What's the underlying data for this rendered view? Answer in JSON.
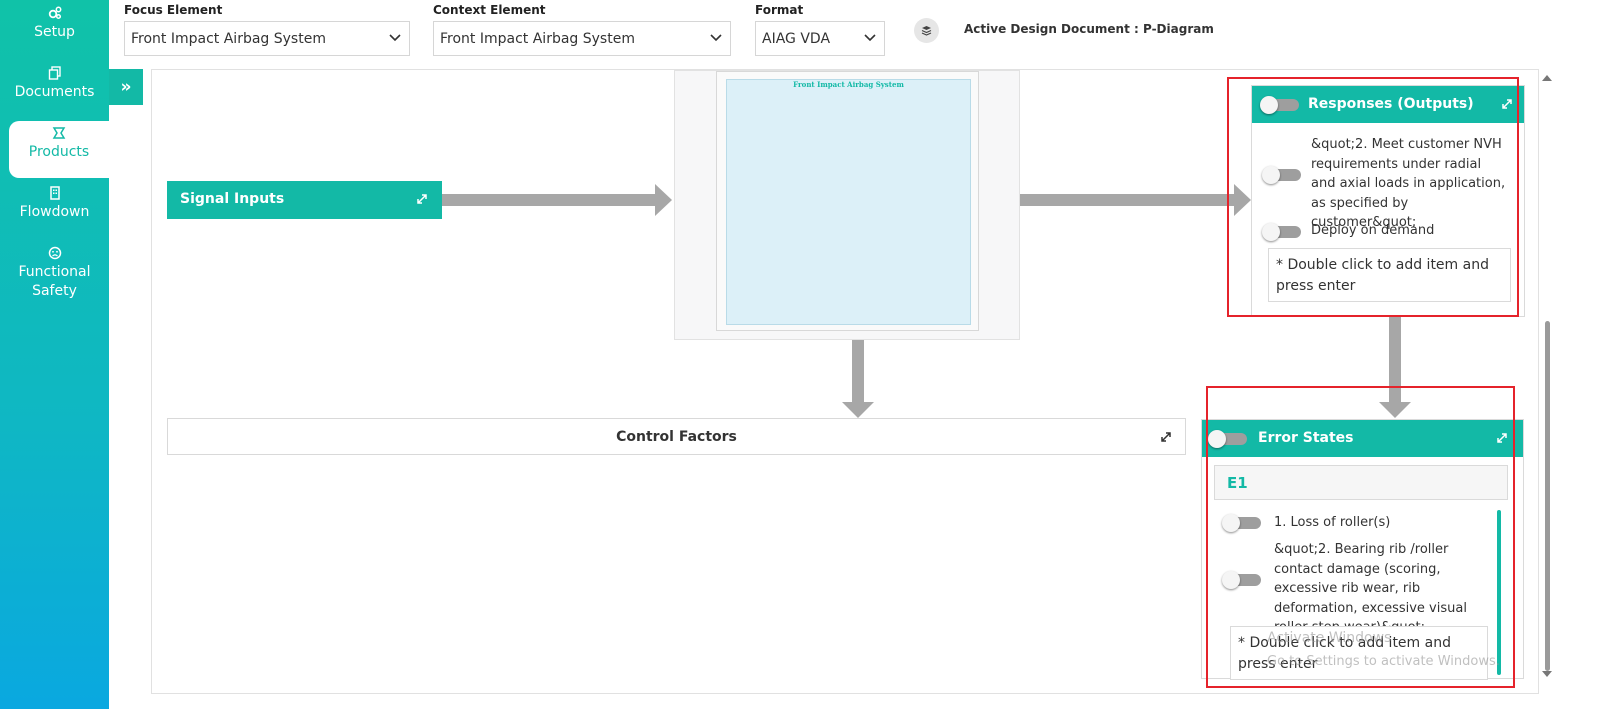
{
  "sidebar": {
    "items": [
      {
        "label": "Setup",
        "icon": "gears-icon"
      },
      {
        "label": "Documents",
        "icon": "documents-icon"
      },
      {
        "label": "Products",
        "icon": "products-icon",
        "active": true
      },
      {
        "label": "Flowdown",
        "icon": "building-icon"
      },
      {
        "label": "Functional Safety",
        "label_line1": "Functional",
        "label_line2": "Safety",
        "icon": "face-icon"
      }
    ]
  },
  "topbar": {
    "focus_label": "Focus Element",
    "focus_value": "Front Impact Airbag System",
    "context_label": "Context Element",
    "context_value": "Front Impact Airbag System",
    "format_label": "Format",
    "format_value": "AIAG VDA",
    "active_doc": "Active Design Document : P-Diagram"
  },
  "diagram": {
    "expander_glyph": "»",
    "center_title": "Front Impact Airbag System",
    "signal_inputs": "Signal Inputs",
    "control_factors": "Control Factors",
    "responses": {
      "title": "Responses (Outputs)",
      "items": [
        "&quot;2. Meet customer NVH requirements under radial and axial loads in application, as specified by customer&quot;",
        "Deploy on demand"
      ],
      "add_hint": "* Double click to add item and press enter"
    },
    "error_states": {
      "title": "Error States",
      "group": "E1",
      "items": [
        "1. Loss of roller(s)",
        "&quot;2. Bearing rib /roller contact damage (scoring, excessive rib wear, rib deformation, excessive visual roller step wear)&quot;"
      ],
      "add_hint": "* Double click to add item and press enter"
    }
  },
  "watermark": {
    "line1": "Activate Windows",
    "line2": "Go to Settings to activate Windows."
  },
  "colors": {
    "accent": "#13b9a6",
    "highlight": "#e5232b",
    "arrow": "#a7a7a7"
  }
}
